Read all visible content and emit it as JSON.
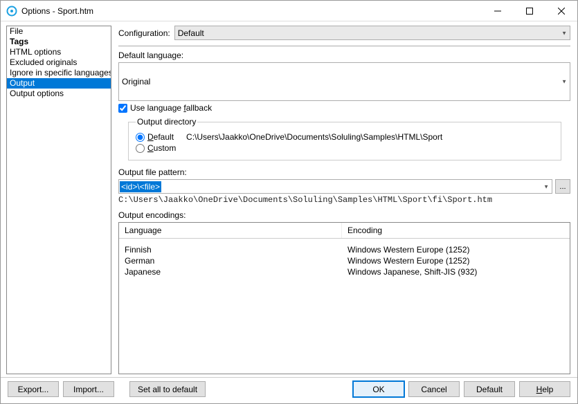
{
  "window": {
    "title": "Options - Sport.htm"
  },
  "sidebar": {
    "items": [
      {
        "label": "File",
        "bold": false,
        "selected": false
      },
      {
        "label": "Tags",
        "bold": true,
        "selected": false
      },
      {
        "label": "HTML options",
        "bold": false,
        "selected": false
      },
      {
        "label": "Excluded originals",
        "bold": false,
        "selected": false
      },
      {
        "label": "Ignore in specific languages",
        "bold": false,
        "selected": false
      },
      {
        "label": "Output",
        "bold": false,
        "selected": true
      },
      {
        "label": "Output options",
        "bold": false,
        "selected": false
      }
    ]
  },
  "config": {
    "label": "Configuration:",
    "value": "Default"
  },
  "default_language": {
    "label": "Default language:",
    "value": "Original"
  },
  "fallback": {
    "label_pre": "Use language ",
    "label_u": "f",
    "label_post": "allback",
    "checked": true
  },
  "outdir": {
    "legend": "Output directory",
    "default_u": "D",
    "default_post": "efault",
    "default_checked": true,
    "default_path": "C:\\Users\\Jaakko\\OneDrive\\Documents\\Soluling\\Samples\\HTML\\Sport",
    "custom_u": "C",
    "custom_post": "ustom",
    "custom_checked": false
  },
  "pattern": {
    "label": "Output file pattern:",
    "value": "<id>\\<file>",
    "resolved": "C:\\Users\\Jaakko\\OneDrive\\Documents\\Soluling\\Samples\\HTML\\Sport\\fi\\Sport.htm",
    "dots": "..."
  },
  "encodings": {
    "label": "Output encodings:",
    "headers": {
      "lang": "Language",
      "enc": "Encoding"
    },
    "rows": [
      {
        "lang": "Finnish",
        "enc": "Windows Western Europe (1252)"
      },
      {
        "lang": "German",
        "enc": "Windows Western Europe (1252)"
      },
      {
        "lang": "Japanese",
        "enc": "Windows Japanese, Shift-JIS (932)"
      }
    ]
  },
  "footer": {
    "export": "Export...",
    "import": "Import...",
    "set_all": "Set all to default",
    "ok": "OK",
    "cancel": "Cancel",
    "default": "Default",
    "help_u": "H",
    "help_post": "elp"
  }
}
